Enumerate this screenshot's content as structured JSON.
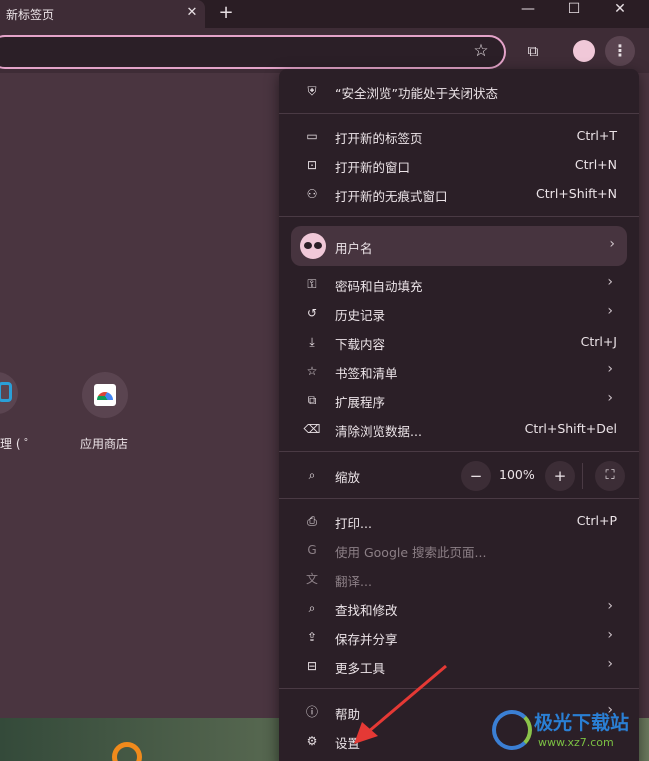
{
  "browser": {
    "tab_title": "新标签页",
    "tab_close": "✕",
    "newtab": "+",
    "window_buttons": {
      "minimize": "—",
      "maximize": "☐",
      "close": "✕"
    }
  },
  "toolbar": {
    "bookmark_star": "☆",
    "extensions": "⧉",
    "menu": "⋮"
  },
  "page": {
    "shortcuts": [
      {
        "label": "理 ( ゜"
      },
      {
        "label": "应用商店"
      }
    ]
  },
  "menu": {
    "safe_browsing": {
      "label": "“安全浏览”功能处于关闭状态"
    },
    "new_tab": {
      "label": "打开新的标签页",
      "shortcut": "Ctrl+T"
    },
    "new_window": {
      "label": "打开新的窗口",
      "shortcut": "Ctrl+N"
    },
    "incognito": {
      "label": "打开新的无痕式窗口",
      "shortcut": "Ctrl+Shift+N"
    },
    "profile": {
      "label": "用户名"
    },
    "passwords": {
      "label": "密码和自动填充"
    },
    "history": {
      "label": "历史记录"
    },
    "downloads": {
      "label": "下载内容",
      "shortcut": "Ctrl+J"
    },
    "bookmarks": {
      "label": "书签和清单"
    },
    "extensions": {
      "label": "扩展程序"
    },
    "clear_data": {
      "label": "清除浏览数据...",
      "shortcut": "Ctrl+Shift+Del"
    },
    "zoom": {
      "label": "缩放",
      "minus": "−",
      "value": "100%",
      "plus": "+",
      "fullscreen": "⛶"
    },
    "print": {
      "label": "打印...",
      "shortcut": "Ctrl+P"
    },
    "google_search": {
      "label": "使用 Google 搜索此页面..."
    },
    "translate": {
      "label": "翻译..."
    },
    "find_edit": {
      "label": "查找和修改"
    },
    "save_share": {
      "label": "保存并分享"
    },
    "more_tools": {
      "label": "更多工具"
    },
    "help": {
      "label": "帮助"
    },
    "settings": {
      "label": "设置"
    },
    "arrow": "›"
  },
  "watermark": {
    "title": "极光下载站",
    "url": "www.xz7.com"
  },
  "colors": {
    "accent": "#e4a3c9",
    "menu_bg": "#2b1f27",
    "page_bg": "#4a3540",
    "annotation": "#e53935"
  }
}
